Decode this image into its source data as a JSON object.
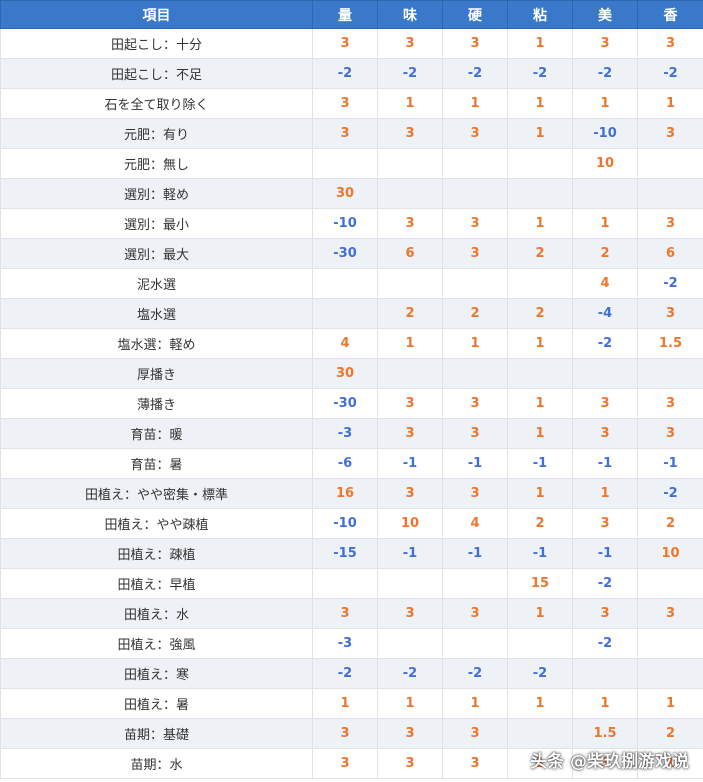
{
  "table": {
    "headers": [
      "項目",
      "量",
      "味",
      "硬",
      "粘",
      "美",
      "香"
    ],
    "rows": [
      [
        "田起こし：十分",
        "3",
        "3",
        "3",
        "1",
        "3",
        "3"
      ],
      [
        "田起こし：不足",
        "-2",
        "-2",
        "-2",
        "-2",
        "-2",
        "-2"
      ],
      [
        "石を全て取り除く",
        "3",
        "1",
        "1",
        "1",
        "1",
        "1"
      ],
      [
        "元肥：有り",
        "3",
        "3",
        "3",
        "1",
        "-10",
        "3"
      ],
      [
        "元肥：無し",
        "",
        "",
        "",
        "",
        "10",
        ""
      ],
      [
        "選別：軽め",
        "30",
        "",
        "",
        "",
        "",
        ""
      ],
      [
        "選別：最小",
        "-10",
        "3",
        "3",
        "1",
        "1",
        "3"
      ],
      [
        "選別：最大",
        "-30",
        "6",
        "3",
        "2",
        "2",
        "6"
      ],
      [
        "泥水選",
        "",
        "",
        "",
        "",
        "4",
        "-2"
      ],
      [
        "塩水選",
        "",
        "2",
        "2",
        "2",
        "-4",
        "3"
      ],
      [
        "塩水選：軽め",
        "4",
        "1",
        "1",
        "1",
        "-2",
        "1.5"
      ],
      [
        "厚播き",
        "30",
        "",
        "",
        "",
        "",
        ""
      ],
      [
        "薄播き",
        "-30",
        "3",
        "3",
        "1",
        "3",
        "3"
      ],
      [
        "育苗：暖",
        "-3",
        "3",
        "3",
        "1",
        "3",
        "3"
      ],
      [
        "育苗：暑",
        "-6",
        "-1",
        "-1",
        "-1",
        "-1",
        "-1"
      ],
      [
        "田植え：やや密集・標準",
        "16",
        "3",
        "3",
        "1",
        "1",
        "-2"
      ],
      [
        "田植え：やや疎植",
        "-10",
        "10",
        "4",
        "2",
        "3",
        "2"
      ],
      [
        "田植え：疎植",
        "-15",
        "-1",
        "-1",
        "-1",
        "-1",
        "10"
      ],
      [
        "田植え：早植",
        "",
        "",
        "",
        "15",
        "-2",
        ""
      ],
      [
        "田植え：水",
        "3",
        "3",
        "3",
        "1",
        "3",
        "3"
      ],
      [
        "田植え：強風",
        "-3",
        "",
        "",
        "",
        "-2",
        ""
      ],
      [
        "田植え：寒",
        "-2",
        "-2",
        "-2",
        "-2",
        "",
        ""
      ],
      [
        "田植え：暑",
        "1",
        "1",
        "1",
        "1",
        "1",
        "1"
      ],
      [
        "苗期：基礎",
        "3",
        "3",
        "3",
        "",
        "1.5",
        "2"
      ],
      [
        "苗期：水",
        "3",
        "3",
        "3",
        "1",
        "3",
        "1"
      ]
    ]
  },
  "watermark": "头条 @柴玖捌游戏说",
  "colors": {
    "header_bg": "#3a78c9",
    "positive": "#f0752d",
    "negative": "#3f6fd8",
    "stripe": "#eef1f5"
  }
}
